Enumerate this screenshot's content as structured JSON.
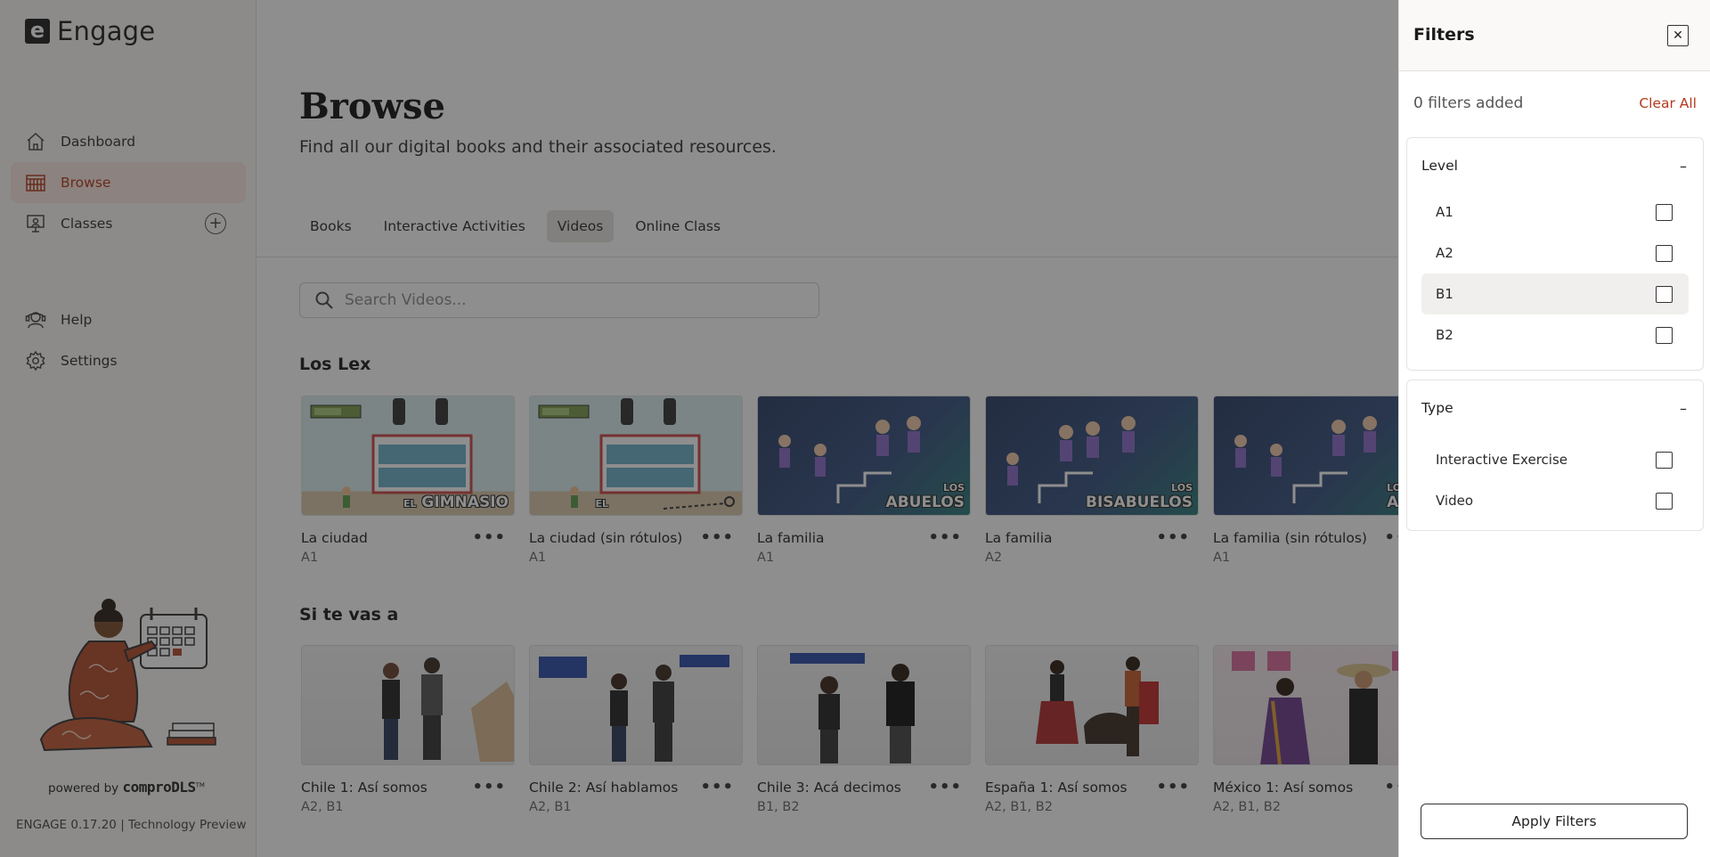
{
  "app": {
    "logo_letter": "e",
    "name": "Engage"
  },
  "sidebar": {
    "items": [
      {
        "label": "Dashboard",
        "icon": "home-icon"
      },
      {
        "label": "Browse",
        "icon": "library-icon",
        "active": true
      },
      {
        "label": "Classes",
        "icon": "classroom-icon",
        "action_icon": "add-circle-icon"
      },
      {
        "label": "Help",
        "icon": "help-icon"
      },
      {
        "label": "Settings",
        "icon": "gear-icon"
      }
    ],
    "powered_by": "powered by",
    "powered_brand": "comproDLS",
    "powered_tm": "TM",
    "version": "ENGAGE 0.17.20 | Technology Preview"
  },
  "main": {
    "title": "Browse",
    "subtitle": "Find all our digital books and their associated resources.",
    "tabs": [
      {
        "label": "Books"
      },
      {
        "label": "Interactive Activities"
      },
      {
        "label": "Videos",
        "active": true
      },
      {
        "label": "Online Class"
      }
    ],
    "search": {
      "placeholder": "Search Videos..."
    },
    "sections": [
      {
        "title": "Los Lex",
        "cards": [
          {
            "title": "La ciudad",
            "levels": "A1",
            "thumb_style": "gym",
            "caption_small": "EL",
            "caption": "GIMNASIO"
          },
          {
            "title": "La ciudad (sin rótulos)",
            "levels": "A1",
            "thumb_style": "gym",
            "caption_small": "EL",
            "caption": ""
          },
          {
            "title": "La familia",
            "levels": "A1",
            "thumb_style": "fam",
            "caption_small": "LOS",
            "caption": "ABUELOS"
          },
          {
            "title": "La familia",
            "levels": "A2",
            "thumb_style": "fam",
            "caption_small": "LOS",
            "caption": "BISABUELOS"
          },
          {
            "title": "La familia (sin rótulos)",
            "levels": "A1",
            "thumb_style": "fam",
            "caption_small": "LOS",
            "caption": "A"
          }
        ]
      },
      {
        "title": "Si te vas a",
        "cards": [
          {
            "title": "Chile 1: Así somos",
            "levels": "A2, B1",
            "thumb_style": "studio",
            "caption_small": "",
            "caption": ""
          },
          {
            "title": "Chile 2: Así hablamos",
            "levels": "A2, B1",
            "thumb_style": "studio",
            "caption_small": "",
            "caption": ""
          },
          {
            "title": "Chile 3: Acá decimos",
            "levels": "B1, B2",
            "thumb_style": "studio",
            "caption_small": "",
            "caption": ""
          },
          {
            "title": "España 1: Así somos",
            "levels": "A2, B1, B2",
            "thumb_style": "studio",
            "caption_small": "",
            "caption": ""
          },
          {
            "title": "México 1: Así somos",
            "levels": "A2, B1, B2",
            "thumb_style": "mx",
            "caption_small": "",
            "caption": ""
          }
        ]
      }
    ],
    "more_label": "•••"
  },
  "filters": {
    "title": "Filters",
    "close_label": "✕",
    "count_text": "0 filters added",
    "clear_all": "Clear All",
    "groups": [
      {
        "title": "Level",
        "collapse_label": "–",
        "options": [
          "A1",
          "A2",
          "B1",
          "B2"
        ]
      },
      {
        "title": "Type",
        "collapse_label": "–",
        "options": [
          "Interactive Exercise",
          "Video"
        ]
      }
    ],
    "apply_label": "Apply Filters"
  },
  "colors": {
    "accent": "#b33a1d",
    "active_bg": "#fbe7e1",
    "overlay": "#1e1e1e"
  }
}
